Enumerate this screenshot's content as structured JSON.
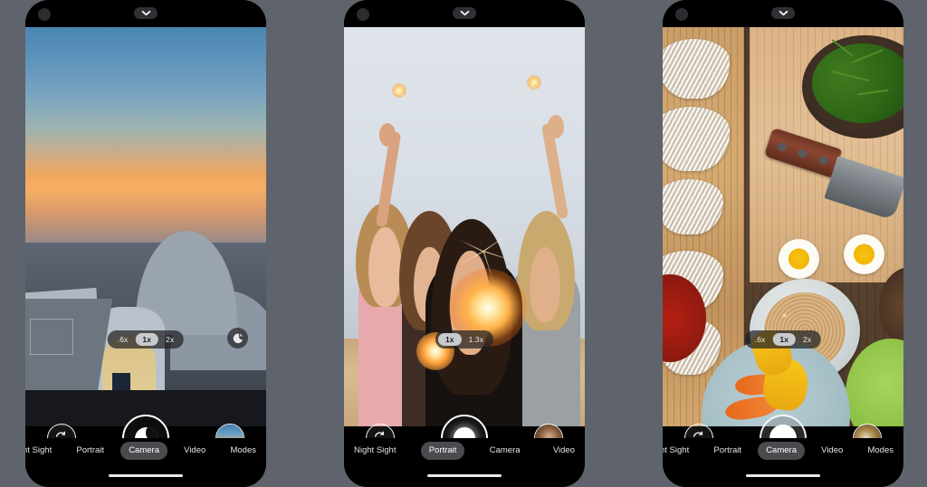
{
  "scene": {
    "background_color": "#5f636b",
    "description": "Three Android phone mockups side by side showing the Google Camera app in different modes"
  },
  "phones": [
    {
      "id": "phone-1",
      "top_bar": {
        "punch_hole_camera": "front-camera-hole",
        "settings_chevron": "chevron-down-icon"
      },
      "viewfinder": {
        "subject": "Twilight seascape over Santorini with white domed buildings",
        "scene_type": "night-landscape"
      },
      "zoom": {
        "options": [
          ".6x",
          "1x",
          "2x"
        ],
        "selected": "1x"
      },
      "night_sight_badge": {
        "label": "A",
        "icon": "night-sight-auto-icon",
        "visible": true
      },
      "controls": {
        "flip_camera": "flip-camera-icon",
        "shutter_style": "night",
        "shutter_icon": "night-sight-shutter-icon",
        "gallery_thumb": "last-photo-thumbnail"
      },
      "modes": [
        {
          "label": "nt Sight",
          "active": false,
          "clipped": true
        },
        {
          "label": "Portrait",
          "active": false,
          "clipped": false
        },
        {
          "label": "Camera",
          "active": true,
          "clipped": false
        },
        {
          "label": "Video",
          "active": false,
          "clipped": false
        },
        {
          "label": "Modes",
          "active": false,
          "clipped": false
        }
      ]
    },
    {
      "id": "phone-2",
      "top_bar": {
        "punch_hole_camera": "front-camera-hole",
        "settings_chevron": "chevron-down-icon"
      },
      "viewfinder": {
        "subject": "Group selfie of five friends holding sparklers on a beach at dusk",
        "scene_type": "portrait-selfie"
      },
      "zoom": {
        "options": [
          "1x",
          "1.3x"
        ],
        "selected": "1x"
      },
      "night_sight_badge": {
        "label": "",
        "icon": "night-sight-auto-icon",
        "visible": false
      },
      "controls": {
        "flip_camera": "flip-camera-icon",
        "shutter_style": "std",
        "shutter_icon": "shutter-icon",
        "gallery_thumb": "last-photo-thumbnail"
      },
      "modes": [
        {
          "label": "Night Sight",
          "active": false,
          "clipped": false
        },
        {
          "label": "Portrait",
          "active": true,
          "clipped": false
        },
        {
          "label": "Camera",
          "active": false,
          "clipped": false
        },
        {
          "label": "Video",
          "active": false,
          "clipped": false
        }
      ]
    },
    {
      "id": "phone-3",
      "top_bar": {
        "punch_hole_camera": "front-camera-hole",
        "settings_chevron": "chevron-down-icon"
      },
      "viewfinder": {
        "subject": "Overhead food flat-lay with noodles, a knife, sauteed greens, boiled eggs and bowls",
        "scene_type": "food-photo"
      },
      "zoom": {
        "options": [
          ".6x",
          "1x",
          "2x"
        ],
        "selected": "1x"
      },
      "night_sight_badge": {
        "label": "",
        "icon": "night-sight-auto-icon",
        "visible": false
      },
      "controls": {
        "flip_camera": "flip-camera-icon",
        "shutter_style": "glass",
        "shutter_icon": "shutter-icon",
        "gallery_thumb": "last-photo-thumbnail"
      },
      "modes": [
        {
          "label": "nt Sight",
          "active": false,
          "clipped": true
        },
        {
          "label": "Portrait",
          "active": false,
          "clipped": false
        },
        {
          "label": "Camera",
          "active": true,
          "clipped": false
        },
        {
          "label": "Video",
          "active": false,
          "clipped": false
        },
        {
          "label": "Modes",
          "active": false,
          "clipped": false
        }
      ]
    }
  ],
  "colors": {
    "background": "#5f636b",
    "phone_body": "#0b0b0c",
    "zoom_pill_bg": "rgba(32,33,36,.72)",
    "zoom_active_bg": "#c8cacd",
    "mode_active_bg": "#4a4b4e",
    "text_primary": "#e3e4e6"
  }
}
